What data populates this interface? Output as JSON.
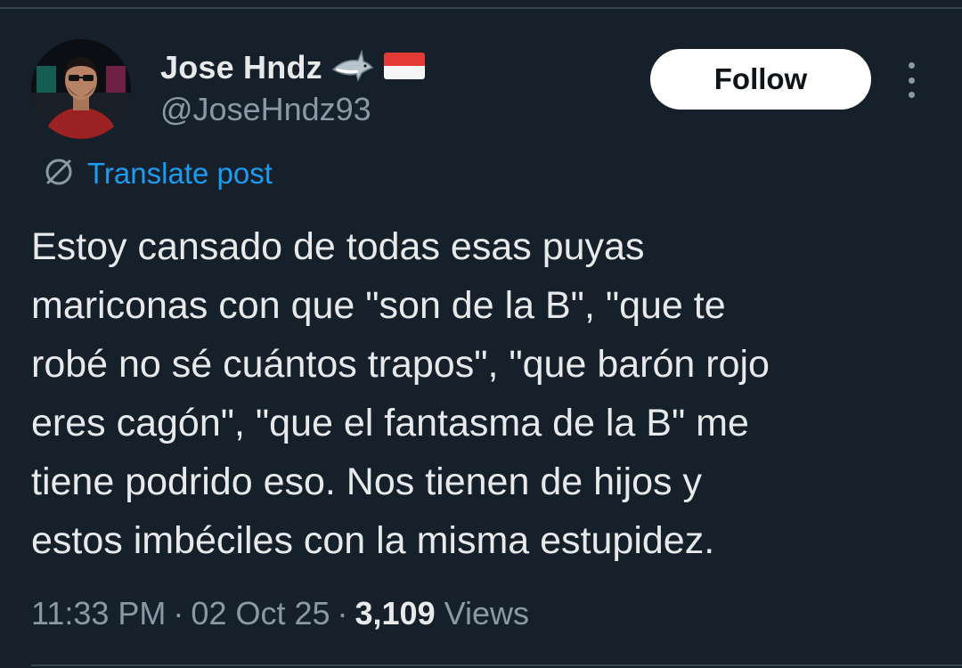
{
  "tweet": {
    "author": {
      "display_name": "Jose Hndz",
      "handle": "@JoseHndz93",
      "badges": [
        "shark-emoji",
        "indonesia-flag-emoji"
      ]
    },
    "follow_label": "Follow",
    "more_icon": "more-vertical-icon",
    "translate": {
      "icon": "translate-globe-icon",
      "label": "Translate post"
    },
    "text_lines": [
      "Estoy cansado de todas esas puyas",
      "mariconas con que \"son de la B\", \"que te",
      "robé no sé cuántos trapos\", \"que barón rojo",
      "eres cagón\", \"que el fantasma de la B\" me",
      "tiene podrido eso. Nos tienen de hijos y",
      "estos imbéciles con la misma estupidez."
    ],
    "meta": {
      "time": "11:33 PM",
      "separator": "·",
      "date": "02 Oct 25",
      "views_count": "3,109",
      "views_label": "Views"
    }
  },
  "colors": {
    "background": "#15202b",
    "text_primary": "#e7e9ea",
    "text_secondary": "#8b98a5",
    "link": "#1d9bf0",
    "follow_bg": "#ffffff",
    "follow_text": "#0f1419",
    "divider": "#38444d"
  }
}
